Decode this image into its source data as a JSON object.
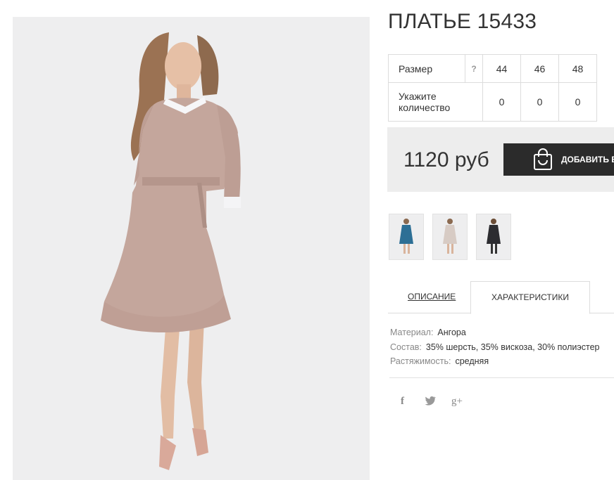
{
  "product": {
    "title": "ПЛАТЬЕ 15433",
    "price": "1120 руб",
    "add_to_cart": "ДОБАВИТЬ В"
  },
  "sizes": {
    "size_label": "Размер",
    "help_mark": "?",
    "values": [
      "44",
      "46",
      "48"
    ],
    "qty_label": "Укажите количество",
    "quantities": [
      "0",
      "0",
      "0"
    ]
  },
  "thumbnails": [
    {
      "name": "blue",
      "color": "#2d6f95"
    },
    {
      "name": "beige",
      "color": "#d7cbc4"
    },
    {
      "name": "dark",
      "color": "#2c2c30"
    }
  ],
  "tabs": {
    "description": "ОПИСАНИЕ",
    "characteristics": "ХАРАКТЕРИСТИКИ"
  },
  "characteristics": [
    {
      "label": "Материал:",
      "value": "Ангора"
    },
    {
      "label": "Состав:",
      "value": "35% шерсть, 35% вискоза, 30% полиэстер"
    },
    {
      "label": "Растяжимость:",
      "value": "средняя"
    }
  ],
  "social": {
    "facebook": "f",
    "twitter": "t",
    "google": "g+"
  },
  "colors": {
    "dress": "#c4a69c",
    "photo_bg": "#eeeeef",
    "price_bg": "#ededed",
    "cart_bg": "#2b2b2b"
  }
}
